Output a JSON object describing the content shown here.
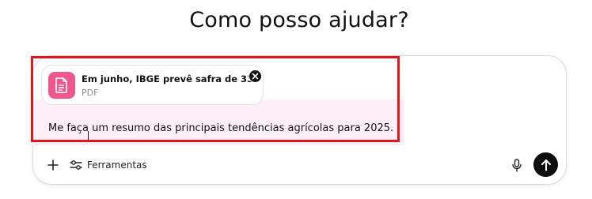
{
  "heading": "Como posso ajudar?",
  "attachment": {
    "name": "Em junho, IBGE prevê safra de 333,3 ...",
    "type": "PDF",
    "icon": "document-icon",
    "icon_color": "#f0578a"
  },
  "prompt": {
    "text": "Me faça um resumo das principais tendências agrícolas para 2025."
  },
  "toolbar": {
    "tools_label": "Ferramentas"
  },
  "colors": {
    "selection_outline": "#e3161c",
    "send_button": "#0d0d0d"
  }
}
